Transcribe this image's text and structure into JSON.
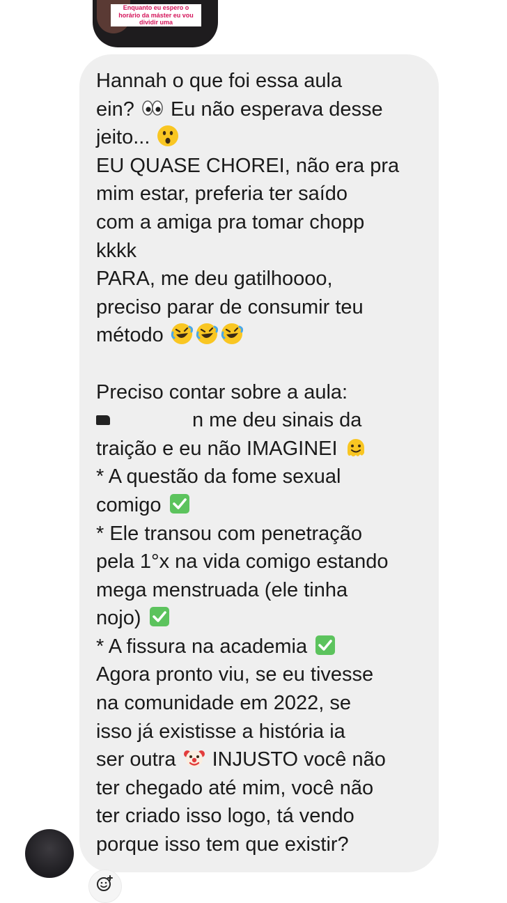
{
  "story_reply": {
    "caption": "Enquanto eu espero o\nhorário da máster eu vou\ndividir uma"
  },
  "message": {
    "lines": [
      "Hannah o que foi essa aula",
      "ein?",
      "Eu não esperava desse",
      "jeito...",
      "EU QUASE CHOREI, não era pra",
      "mim estar, preferia ter saído",
      "com a amiga pra tomar chopp",
      "kkkk",
      "PARA, me deu gatilhoooo,",
      "preciso parar de consumir teu",
      "método",
      "Preciso contar sobre a aula:",
      "n me deu sinais da",
      "traição e eu não IMAGINEI",
      "* A questão da fome sexual",
      "comigo",
      "* Ele transou com penetração",
      "pela 1°x na vida comigo estando",
      "mega menstruada (ele tinha",
      "nojo)",
      "* A fissura na academia",
      "Agora pronto viu, se eu tivesse",
      "na comunidade em 2022, se",
      "isso já existisse a história ia",
      "ser outra",
      "INJUSTO você não",
      "ter chegado até mim, você não",
      "ter criado isso logo, tá vendo",
      "porque isso tem que existir?"
    ],
    "emojis": {
      "eyes": "eyes-emoji",
      "astonished": "astonished-face-emoji",
      "rofl": "rolling-on-floor-laughing-emoji",
      "melting": "melting-face-emoji",
      "check": "check-mark-button-emoji",
      "clown": "clown-face-emoji"
    }
  },
  "colors": {
    "bubble": "#efefef",
    "text": "#1a1a1a",
    "check_green": "#5cc35d",
    "emoji_yellow": "#f9c622"
  },
  "actions": {
    "react_icon": "add-reaction-icon"
  }
}
